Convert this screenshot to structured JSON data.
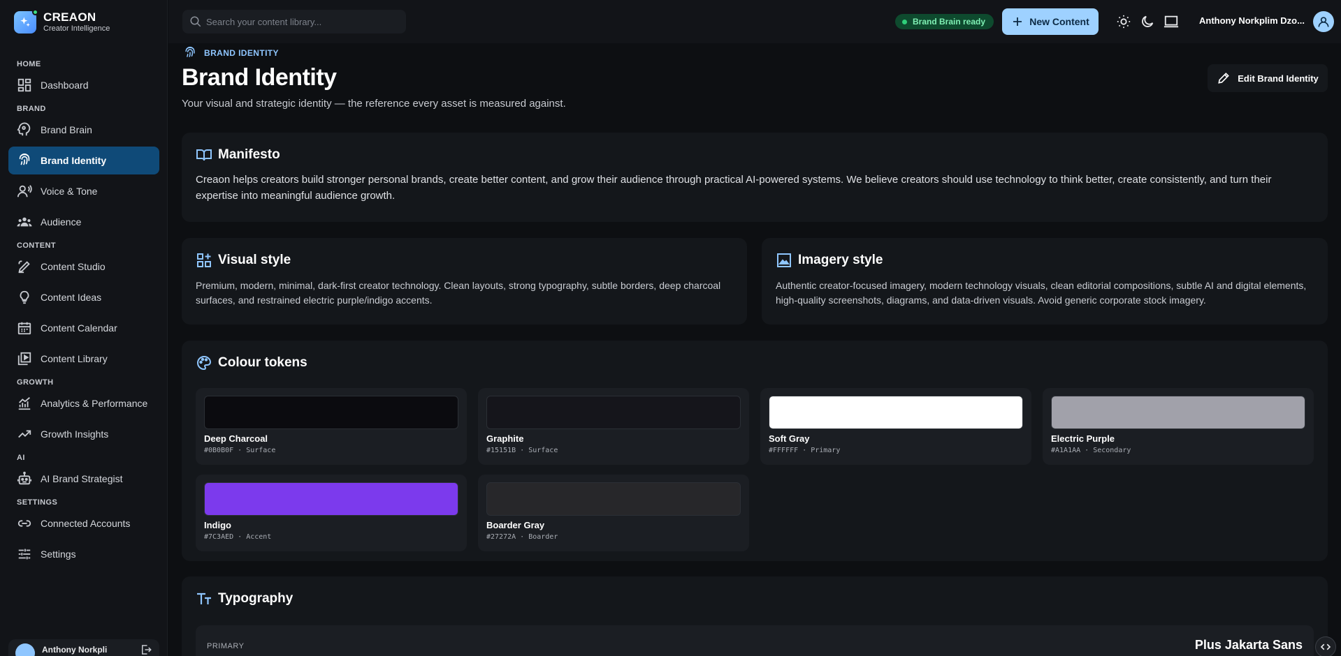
{
  "app": {
    "name": "CREAON",
    "tagline": "Creator Intelligence"
  },
  "sidebar": {
    "sections": {
      "home": "HOME",
      "brand": "BRAND",
      "content": "CONTENT",
      "growth": "GROWTH",
      "ai": "AI",
      "settings": "SETTINGS"
    },
    "items": {
      "dashboard": "Dashboard",
      "brand_brain": "Brand Brain",
      "brand_identity": "Brand Identity",
      "voice_tone": "Voice & Tone",
      "audience": "Audience",
      "content_studio": "Content Studio",
      "content_ideas": "Content Ideas",
      "content_calendar": "Content Calendar",
      "content_library": "Content Library",
      "analytics": "Analytics & Performance",
      "growth_insights": "Growth Insights",
      "ai_strategist": "AI Brand Strategist",
      "connected_accounts": "Connected Accounts",
      "settings": "Settings"
    },
    "active": "brand_identity",
    "user_name": "Anthony Norkpli"
  },
  "topbar": {
    "search_placeholder": "Search your content library...",
    "status": "Brand Brain ready",
    "new_content": "New Content",
    "user_name": "Anthony Norkplim Dzo..."
  },
  "page": {
    "breadcrumb": "BRAND IDENTITY",
    "title": "Brand Identity",
    "subtitle": "Your visual and strategic identity — the reference every asset is measured against.",
    "edit_button": "Edit Brand Identity"
  },
  "manifesto": {
    "title": "Manifesto",
    "body": "Creaon helps creators build stronger personal brands, create better content, and grow their audience through practical AI-powered systems. We believe creators should use technology to think better, create consistently, and turn their expertise into meaningful audience growth."
  },
  "visual_style": {
    "title": "Visual style",
    "body": "Premium, modern, minimal, dark-first creator technology. Clean layouts, strong typography, subtle borders, deep charcoal surfaces, and restrained electric purple/indigo accents."
  },
  "imagery_style": {
    "title": "Imagery style",
    "body": "Authentic creator-focused imagery, modern technology visuals, clean editorial compositions, subtle AI and digital elements, high-quality screenshots, diagrams, and data-driven visuals. Avoid generic corporate stock imagery."
  },
  "colour_tokens": {
    "title": "Colour tokens",
    "tokens": [
      {
        "name": "Deep Charcoal",
        "hex": "#0B0B0F",
        "role": "Surface",
        "meta": "#0B0B0F · Surface"
      },
      {
        "name": "Graphite",
        "hex": "#15151B",
        "role": "Surface",
        "meta": "#15151B · Surface"
      },
      {
        "name": "Soft Gray",
        "hex": "#FFFFFF",
        "role": "Primary",
        "meta": "#FFFFFF · Primary"
      },
      {
        "name": "Electric Purple",
        "hex": "#A1A1AA",
        "role": "Secondary",
        "meta": "#A1A1AA · Secondary"
      },
      {
        "name": "Indigo",
        "hex": "#7C3AED",
        "role": "Accent",
        "meta": "#7C3AED · Accent"
      },
      {
        "name": "Boarder Gray",
        "hex": "#27272A",
        "role": "Boarder",
        "meta": "#27272A · Boarder"
      }
    ]
  },
  "typography": {
    "title": "Typography",
    "primary_label": "PRIMARY",
    "primary_font": "Plus Jakarta Sans"
  },
  "colors": {
    "accent": "#9ED1FF",
    "active_nav": "#0F4A78",
    "ready_green": "#2FCF7A"
  }
}
